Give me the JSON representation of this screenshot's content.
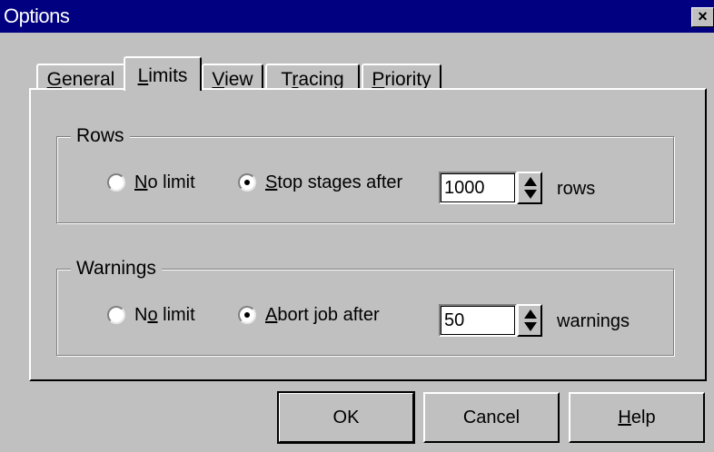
{
  "window": {
    "title": "Options",
    "close_glyph": "×"
  },
  "tabs": [
    {
      "pre": "",
      "key": "G",
      "post": "eneral"
    },
    {
      "pre": "",
      "key": "L",
      "post": "imits"
    },
    {
      "pre": "",
      "key": "V",
      "post": "iew"
    },
    {
      "pre": "T",
      "key": "r",
      "post": "acing"
    },
    {
      "pre": "",
      "key": "P",
      "post": "riority"
    }
  ],
  "active_tab": "Limits",
  "rows_group": {
    "legend": "Rows",
    "no_limit": {
      "pre": "",
      "key": "N",
      "post": "o limit"
    },
    "stop": {
      "pre": "",
      "key": "S",
      "post": "top stages after"
    },
    "value": "1000",
    "unit": "rows",
    "selected": "stop"
  },
  "warnings_group": {
    "legend": "Warnings",
    "no_limit": {
      "pre": "N",
      "key": "o",
      "post": " limit"
    },
    "abort": {
      "pre": "",
      "key": "A",
      "post": "bort job after"
    },
    "value": "50",
    "unit": "warnings",
    "selected": "abort"
  },
  "buttons": {
    "ok": "OK",
    "cancel": "Cancel",
    "help": {
      "pre": "",
      "key": "H",
      "post": "elp"
    }
  },
  "icons": {
    "close": "close-icon",
    "spinner": "up-down-arrow-icon",
    "radio": "radio-button-icon"
  }
}
